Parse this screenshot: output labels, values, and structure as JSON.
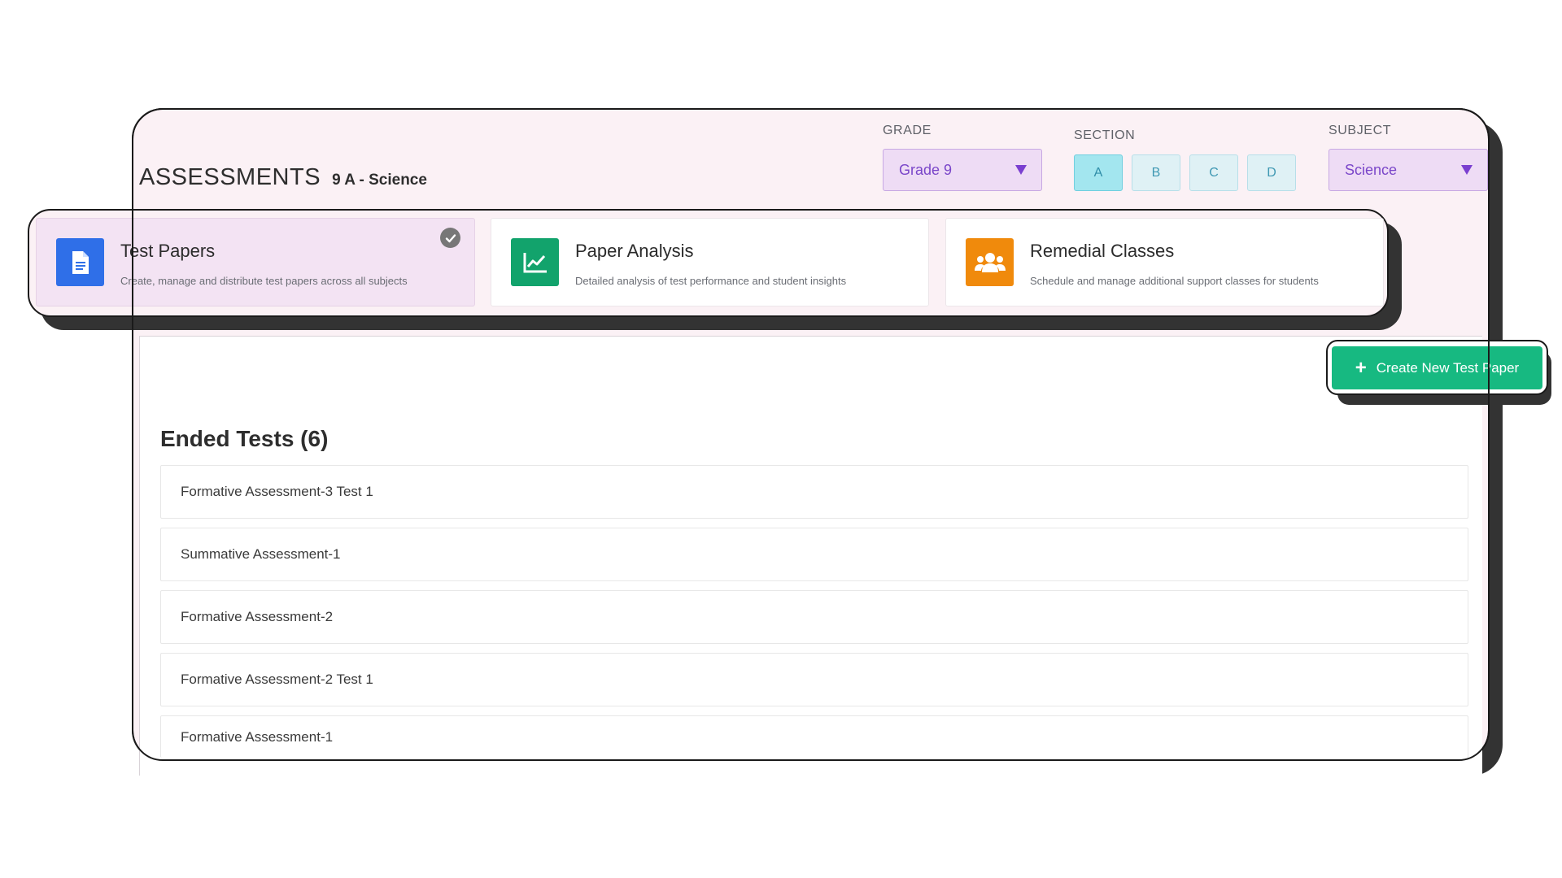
{
  "header": {
    "title": "ASSESSMENTS",
    "context": "9 A - Science"
  },
  "filters": {
    "grade": {
      "label": "GRADE",
      "value": "Grade 9"
    },
    "section": {
      "label": "SECTION",
      "options": [
        "A",
        "B",
        "C",
        "D"
      ],
      "selected": "A"
    },
    "subject": {
      "label": "SUBJECT",
      "value": "Science"
    }
  },
  "cards": [
    {
      "title": "Test Papers",
      "description": "Create, manage and distribute test papers across all subjects",
      "icon": "document-icon",
      "color": "#2f6fe8",
      "selected": true
    },
    {
      "title": "Paper Analysis",
      "description": "Detailed analysis of test performance and student insights",
      "icon": "chart-icon",
      "color": "#12a36c",
      "selected": false
    },
    {
      "title": "Remedial Classes",
      "description": "Schedule and manage additional support classes for students",
      "icon": "users-icon",
      "color": "#f08a0c",
      "selected": false
    }
  ],
  "actions": {
    "create_label": "Create New Test Paper",
    "create_color": "#17b981"
  },
  "ended_tests": {
    "heading": "Ended Tests (6)",
    "items": [
      "Formative Assessment-3 Test 1",
      "Summative Assessment-1",
      "Formative Assessment-2",
      "Formative Assessment-2 Test 1",
      "Formative Assessment-1"
    ]
  }
}
